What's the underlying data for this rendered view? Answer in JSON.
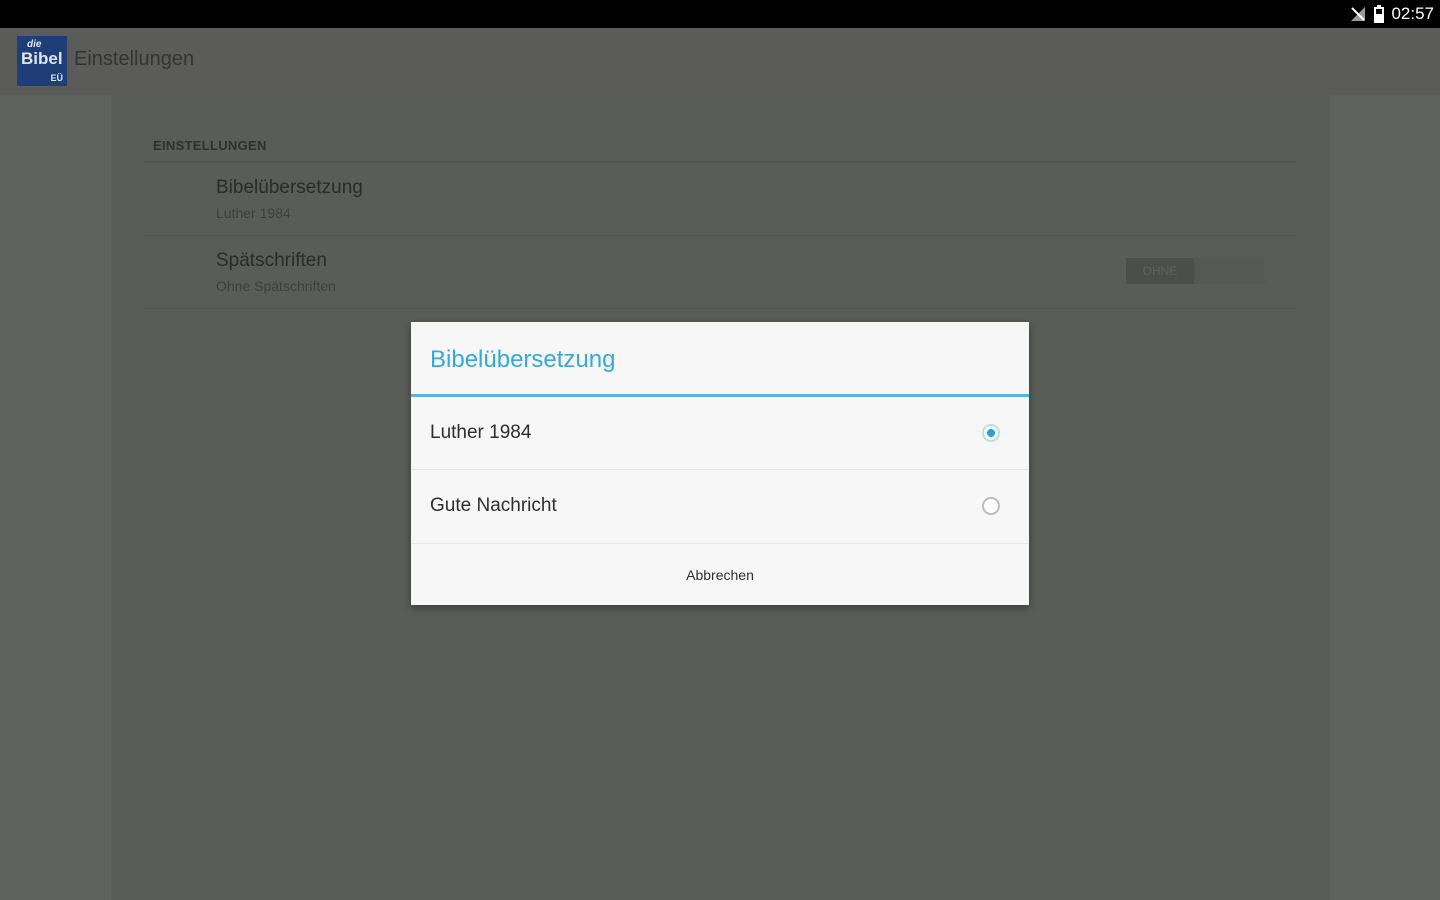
{
  "status_bar": {
    "time": "02:57",
    "icons": [
      "signal-off-icon",
      "battery-icon"
    ]
  },
  "action_bar": {
    "logo": {
      "line1": "die",
      "line2": "Bibel",
      "line3": "EÜ"
    },
    "title": "Einstellungen"
  },
  "settings": {
    "section_header": "EINSTELLUNGEN",
    "items": [
      {
        "title": "Bibelübersetzung",
        "summary": "Luther 1984"
      },
      {
        "title": "Spätschriften",
        "summary": "Ohne Spätschriften",
        "toggle_label": "OHNE",
        "toggle_on": false
      }
    ]
  },
  "dialog": {
    "title": "Bibelübersetzung",
    "options": [
      {
        "label": "Luther 1984",
        "selected": true
      },
      {
        "label": "Gute Nachricht",
        "selected": false
      }
    ],
    "cancel_label": "Abbrechen",
    "accent_color": "#35a9da"
  }
}
